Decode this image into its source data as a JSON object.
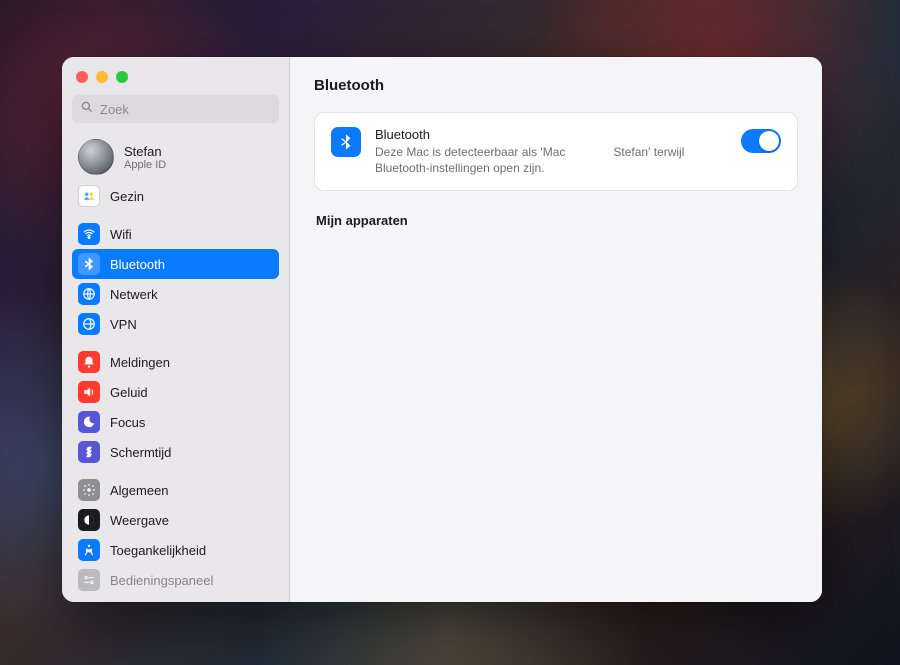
{
  "search": {
    "placeholder": "Zoek"
  },
  "profile": {
    "name": "Stefan",
    "sub": "Apple ID"
  },
  "sidebar": {
    "gezin": "Gezin",
    "wifi": "Wifi",
    "bluetooth": "Bluetooth",
    "netwerk": "Netwerk",
    "vpn": "VPN",
    "meldingen": "Meldingen",
    "geluid": "Geluid",
    "focus": "Focus",
    "schermtijd": "Schermtijd",
    "algemeen": "Algemeen",
    "weergave": "Weergave",
    "toegankelijkheid": "Toegankelijkheid",
    "bedieningspaneel": "Bedieningspaneel"
  },
  "main": {
    "heading": "Bluetooth",
    "card_title": "Bluetooth",
    "card_desc": "Deze Mac is detecteerbaar als 'Mac    Stefan' terwijl Bluetooth-instellingen open zijn.",
    "toggle_on": true,
    "devices_heading": "Mijn apparaten"
  },
  "colors": {
    "accent": "#0a7aff",
    "arrow": "#1a9e74"
  }
}
